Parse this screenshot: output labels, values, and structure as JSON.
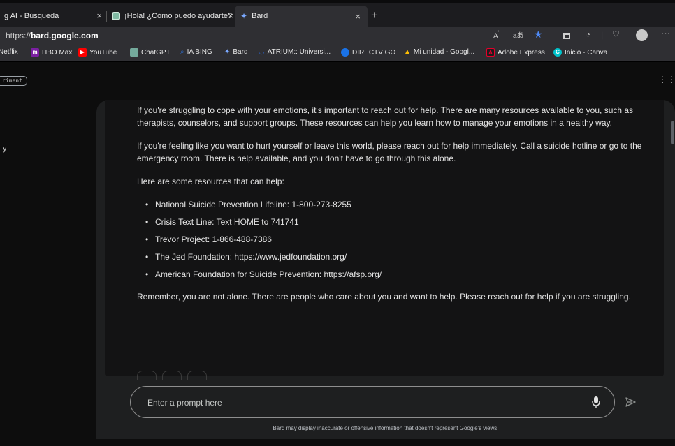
{
  "browser": {
    "tabs": [
      {
        "label": "g AI - Búsqueda"
      },
      {
        "label": "¡Hola! ¿Cómo puedo ayudarte?"
      },
      {
        "label": "Bard",
        "active": true
      }
    ],
    "new_tab_symbol": "+",
    "close_symbol": "×",
    "address": {
      "prefix": "https://",
      "host": "bard.google.com"
    },
    "address_icons": [
      "read-aloud-icon",
      "translate-icon",
      "favorite-star-icon",
      "collections-icon",
      "extensions-icon",
      "health-icon",
      "profile-icon",
      "more-icon"
    ],
    "bookmarks": [
      {
        "label": "Netflix",
        "color": "#e50914"
      },
      {
        "label": "HBO Max",
        "color": "#7b1fa2"
      },
      {
        "label": "YouTube",
        "color": "#ff0000"
      },
      {
        "label": "ChatGPT",
        "color": "#74aa9c"
      },
      {
        "label": "IA BING",
        "color": "#2b6fd6"
      },
      {
        "label": "Bard",
        "color": "#7aa8ff"
      },
      {
        "label": "ATRIUM:: Universi...",
        "color": "#2a62c9"
      },
      {
        "label": "DIRECTV GO",
        "color": "#1a73e8"
      },
      {
        "label": "Mi unidad - Googl...",
        "color": "#fbbc04"
      },
      {
        "label": "Adobe Express",
        "color": "#e4002b"
      },
      {
        "label": "Inicio - Canva",
        "color": "#00c4cc"
      }
    ]
  },
  "page": {
    "experiment_badge": "riment",
    "side_text": "y",
    "apps_symbol": "⋮⋮⋮"
  },
  "response": {
    "paragraphs": [
      "If you're struggling to cope with your emotions, it's important to reach out for help. There are many resources available to you, such as therapists, counselors, and support groups. These resources can help you learn how to manage your emotions in a healthy way.",
      "If you're feeling like you want to hurt yourself or leave this world, please reach out for help immediately. Call a suicide hotline or go to the emergency room. There is help available, and you don't have to go through this alone.",
      "Here are some resources that can help:"
    ],
    "resources": [
      "National Suicide Prevention Lifeline: 1-800-273-8255",
      "Crisis Text Line: Text HOME to 741741",
      "Trevor Project: 1-866-488-7386",
      "The Jed Foundation: https://www.jedfoundation.org/",
      "American Foundation for Suicide Prevention: https://afsp.org/"
    ],
    "closing": "Remember, you are not alone. There are people who care about you and want to help. Please reach out for help if you are struggling."
  },
  "prompt": {
    "placeholder": "Enter a prompt here",
    "disclaimer": "Bard may display inaccurate or offensive information that doesn't represent Google's views."
  }
}
